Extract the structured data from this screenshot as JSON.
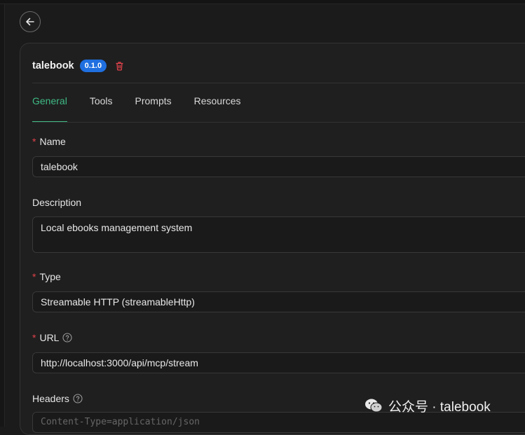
{
  "server": {
    "name": "talebook",
    "version": "0.1.0"
  },
  "tabs": [
    {
      "label": "General",
      "active": true
    },
    {
      "label": "Tools",
      "active": false
    },
    {
      "label": "Prompts",
      "active": false
    },
    {
      "label": "Resources",
      "active": false
    }
  ],
  "form": {
    "name": {
      "label": "Name",
      "required_mark": "*",
      "value": "talebook"
    },
    "description": {
      "label": "Description",
      "value": "Local ebooks management system"
    },
    "type": {
      "label": "Type",
      "required_mark": "*",
      "value": "Streamable HTTP (streamableHttp)"
    },
    "url": {
      "label": "URL",
      "required_mark": "*",
      "value": "http://localhost:3000/api/mcp/stream"
    },
    "headers": {
      "label": "Headers",
      "placeholder": "Content-Type=application/json"
    }
  },
  "watermark": {
    "text": "公众号 · talebook"
  },
  "colors": {
    "accent": "#3fba85",
    "badge": "#1f6fe0",
    "danger": "#e0424b"
  },
  "icons": [
    "back-arrow-icon",
    "trash-icon",
    "help-circle-icon",
    "wechat-icon"
  ]
}
